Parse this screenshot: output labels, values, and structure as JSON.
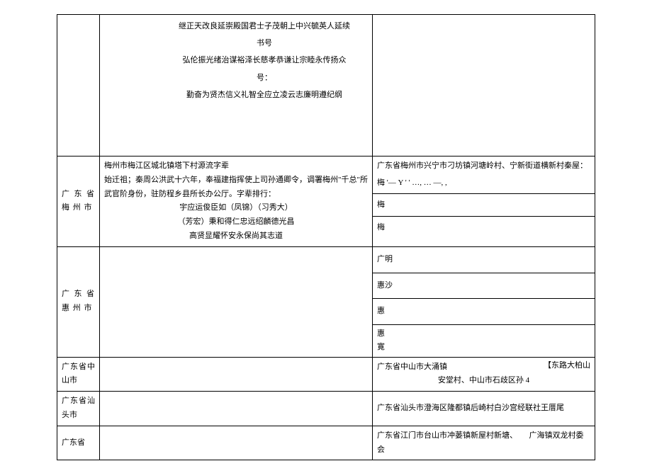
{
  "row1": {
    "poem1": "继正天改良延崇殿国君士子茂朝上中兴毓英人延续书号",
    "poem2": "弘伦振光绪治谋裕泽长慈孝恭谦让宗睦永传扬众号：",
    "poem3": "勤奋为贤杰信义礼智全应立凌云志廉明遵纪纲"
  },
  "row2": {
    "region": "广 东 省 梅 州 市",
    "line1": "梅州市梅江区城北镇塔下村源流字辈",
    "line2": "始迁祖；秦周公洪武十六年，奉福建指挥使上司孙通卿令，调署梅州\"千总\"所武官阶身份，驻防程乡县所长办公厅。字辈排行：",
    "line3": "宇应运俊臣如（凤锦）（习秀大）",
    "line4": "（芳宏）秉和得仁忠远绍麟德光昌",
    "line5": "高贤显耀怀安永保尚其志道",
    "right_line1": "广东省梅州市兴宁市刁坊镇河塘岭村、宁新街道横新村秦屋：",
    "right_line2": "梅 '— Y ' ' …, … —, ,",
    "right_line3": "梅",
    "right_line4": "梅"
  },
  "row3": {
    "region": "广 东 省 惠 州 市",
    "r1": "广明",
    "r2": "惠沙",
    "r3": "惠",
    "r4": "惠",
    "r5": "寛"
  },
  "row4": {
    "region": "广东省中山市",
    "right_a": "广东省中山市大涌镇",
    "right_b": "安堂村、中山市石歧区孙 4",
    "right_c": "【东路大柏山"
  },
  "row5": {
    "region": "广东省汕头市",
    "right": "广东省汕头市澄海区隆都镇后崎村白沙宫经联社王厝尾"
  },
  "row6": {
    "region": "广东省",
    "right_a": "广东省江门市台山市冲蒌镇新屋村新塘、",
    "right_b": "广海镇双龙村委会"
  }
}
